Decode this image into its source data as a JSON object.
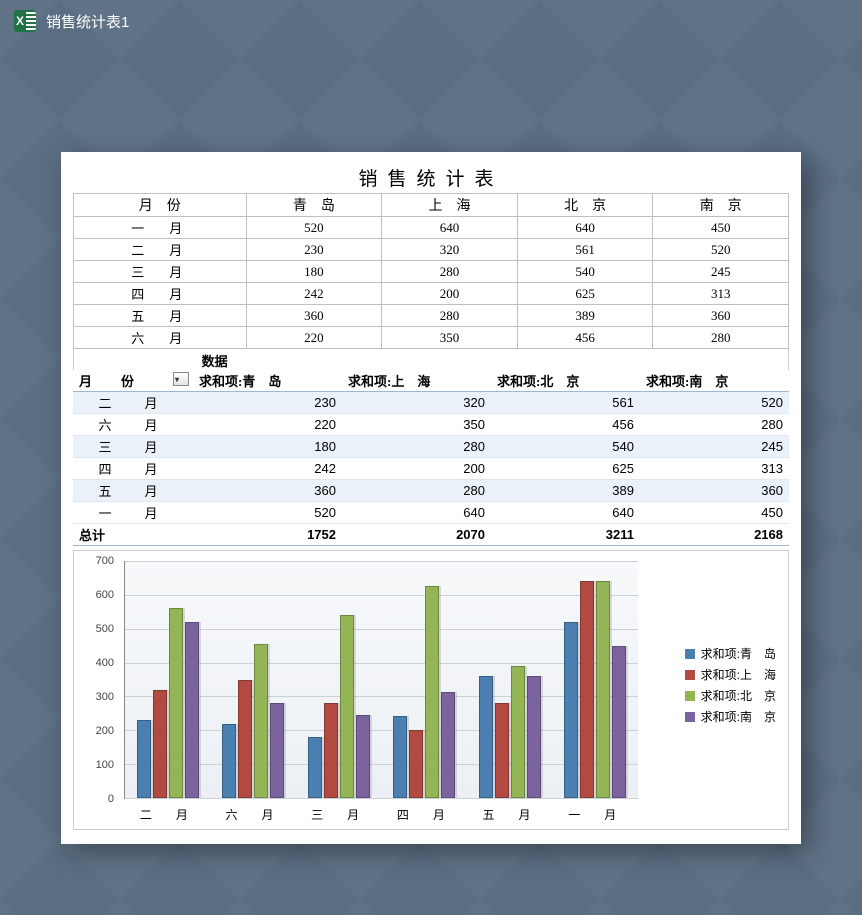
{
  "titlebar": {
    "filename": "销售统计表1"
  },
  "sheet_title": "销售统计表",
  "data_table": {
    "headers": [
      "月　份",
      "青　岛",
      "上　海",
      "北　京",
      "南　京"
    ],
    "rows": [
      {
        "month": "一　月",
        "values": [
          520,
          640,
          640,
          450
        ]
      },
      {
        "month": "二　月",
        "values": [
          230,
          320,
          561,
          520
        ]
      },
      {
        "month": "三　月",
        "values": [
          180,
          280,
          540,
          245
        ]
      },
      {
        "month": "四　月",
        "values": [
          242,
          200,
          625,
          313
        ]
      },
      {
        "month": "五　月",
        "values": [
          360,
          280,
          389,
          360
        ]
      },
      {
        "month": "六　月",
        "values": [
          220,
          350,
          456,
          280
        ]
      }
    ]
  },
  "pivot": {
    "data_label": "数据",
    "month_header": "月　份",
    "headers": [
      "求和项:青　岛",
      "求和项:上　海",
      "求和项:北　京",
      "求和项:南　京"
    ],
    "rows": [
      {
        "month": "二　月",
        "values": [
          230,
          320,
          561,
          520
        ]
      },
      {
        "month": "六　月",
        "values": [
          220,
          350,
          456,
          280
        ]
      },
      {
        "month": "三　月",
        "values": [
          180,
          280,
          540,
          245
        ]
      },
      {
        "month": "四　月",
        "values": [
          242,
          200,
          625,
          313
        ]
      },
      {
        "month": "五　月",
        "values": [
          360,
          280,
          389,
          360
        ]
      },
      {
        "month": "一　月",
        "values": [
          520,
          640,
          640,
          450
        ]
      }
    ],
    "total_label": "总计",
    "totals": [
      1752,
      2070,
      3211,
      2168
    ]
  },
  "chart_data": {
    "type": "bar",
    "categories": [
      "二　月",
      "六　月",
      "三　月",
      "四　月",
      "五　月",
      "一　月"
    ],
    "series": [
      {
        "name": "求和项:青　岛",
        "values": [
          230,
          220,
          180,
          242,
          360,
          520
        ],
        "color": "#4a7fb0"
      },
      {
        "name": "求和项:上　海",
        "values": [
          320,
          350,
          280,
          200,
          280,
          640
        ],
        "color": "#b24a42"
      },
      {
        "name": "求和项:北　京",
        "values": [
          561,
          456,
          540,
          625,
          389,
          640
        ],
        "color": "#93b556"
      },
      {
        "name": "求和项:南　京",
        "values": [
          520,
          280,
          245,
          313,
          360,
          450
        ],
        "color": "#7b649e"
      }
    ],
    "ylim": [
      0,
      700
    ],
    "yticks": [
      0,
      100,
      200,
      300,
      400,
      500,
      600,
      700
    ],
    "title": "",
    "xlabel": "",
    "ylabel": ""
  }
}
